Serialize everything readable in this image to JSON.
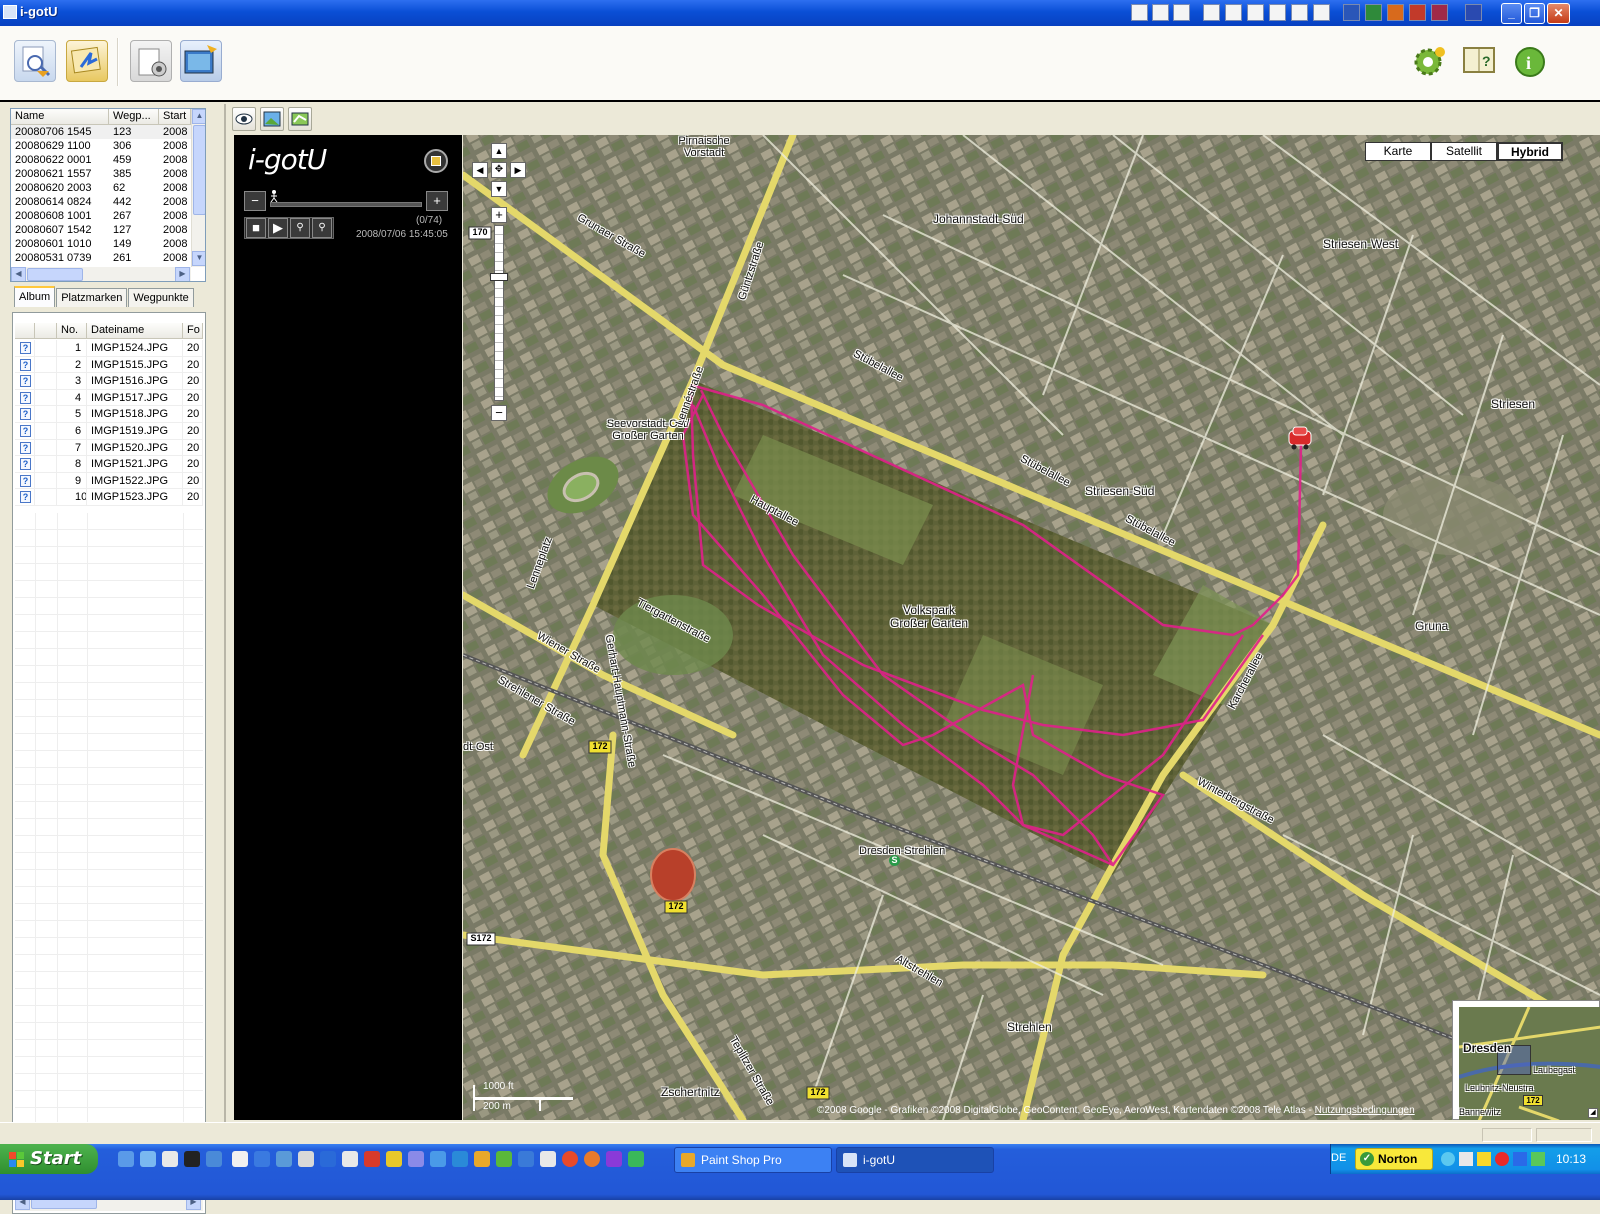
{
  "window": {
    "title": "i-gotU"
  },
  "waypoint_list": {
    "columns": [
      "Name",
      "Wegp...",
      "Start"
    ],
    "rows": [
      [
        "20080706 1545",
        "123",
        "2008"
      ],
      [
        "20080629 1100",
        "306",
        "2008"
      ],
      [
        "20080622 0001",
        "459",
        "2008"
      ],
      [
        "20080621 1557",
        "385",
        "2008"
      ],
      [
        "20080620 2003",
        "62",
        "2008"
      ],
      [
        "20080614 0824",
        "442",
        "2008"
      ],
      [
        "20080608 1001",
        "267",
        "2008"
      ],
      [
        "20080607 1542",
        "127",
        "2008"
      ],
      [
        "20080601 1010",
        "149",
        "2008"
      ],
      [
        "20080531 0739",
        "261",
        "2008"
      ]
    ]
  },
  "tabs": [
    "Album",
    "Platzmarken",
    "Wegpunkte"
  ],
  "album": {
    "columns": [
      "",
      "",
      "No.",
      "Dateiname",
      "Fo"
    ],
    "rows": [
      [
        "1",
        "IMGP1524.JPG",
        "20"
      ],
      [
        "2",
        "IMGP1515.JPG",
        "20"
      ],
      [
        "3",
        "IMGP1516.JPG",
        "20"
      ],
      [
        "4",
        "IMGP1517.JPG",
        "20"
      ],
      [
        "5",
        "IMGP1518.JPG",
        "20"
      ],
      [
        "6",
        "IMGP1519.JPG",
        "20"
      ],
      [
        "7",
        "IMGP1520.JPG",
        "20"
      ],
      [
        "8",
        "IMGP1521.JPG",
        "20"
      ],
      [
        "9",
        "IMGP1522.JPG",
        "20"
      ],
      [
        "10",
        "IMGP1523.JPG",
        "20"
      ]
    ]
  },
  "player": {
    "logo": "i-gotU",
    "count": "(0/74)",
    "timestamp": "2008/07/06 15:45:05",
    "progress": 0
  },
  "map": {
    "types": [
      "Karte",
      "Satellit",
      "Hybrid"
    ],
    "active_type": "Hybrid",
    "labels": {
      "pirnaische": "Pirnaische Vorstadt",
      "johannstadt": "Johannstadt-Süd",
      "striesen_west": "Striesen-West",
      "striesen": "Striesen",
      "striesen_sud": "Striesen-Süd",
      "seevorstadt": "Seevorstadt-Ost/ Großer Garten",
      "volkspark": "Volkspark Großer Garten",
      "gruna": "Gruna",
      "strehlen": "Strehlen",
      "zschertnitz": "Zschertnitz",
      "dresden_strehlen": "Dresden-Strehlen",
      "stubelallee_1": "Stübelallee",
      "stubelallee_2": "Stübelallee",
      "stubelallee_3": "Stübelallee",
      "grunaer": "Grunaer Straße",
      "guntzstr": "Güntzstraße",
      "lennestr": "Lennéstraße",
      "lenneplatz": "Lenneplatz",
      "wiener": "Wiener Straße",
      "hauptallee": "Hauptallee",
      "karcherallee": "Karcherallee",
      "winterbergstr": "Winterbergstraße",
      "tiergartenstr": "Tiergartenstraße",
      "teplitzer": "Teplitzer Straße",
      "gerhart": "Gerhart-Hauptmann-Straße",
      "strehlener": "Strehlener Straße",
      "altstrehlen": "Altstrehlen",
      "dt_ost": "dt-Ost",
      "r170": "170",
      "r172a": "172",
      "r172b": "172",
      "r172c": "172",
      "s172": "S172"
    },
    "scale": {
      "ft": "1000 ft",
      "m": "200 m"
    },
    "copyright": "©2008 Google - Grafiken ©2008 DigitalGlobe, GeoContent, GeoEye, AeroWest, Kartendaten ©2008 Tele Atlas -",
    "terms_link": "Nutzungsbedingungen",
    "overview": {
      "city": "Dresden",
      "place1": "Laubegast",
      "place2": "Leubnitz-Neustra",
      "place3": "Bannewitz",
      "road": "172"
    }
  },
  "taskbar": {
    "start": "Start",
    "tasks": [
      "Paint Shop Pro",
      "i-gotU"
    ],
    "lang": "DE",
    "norton": "Norton",
    "clock": "10:13"
  },
  "colors": {
    "track": "#e0208a",
    "road": "#e8dc6a",
    "xp_blue": "#245edb"
  }
}
